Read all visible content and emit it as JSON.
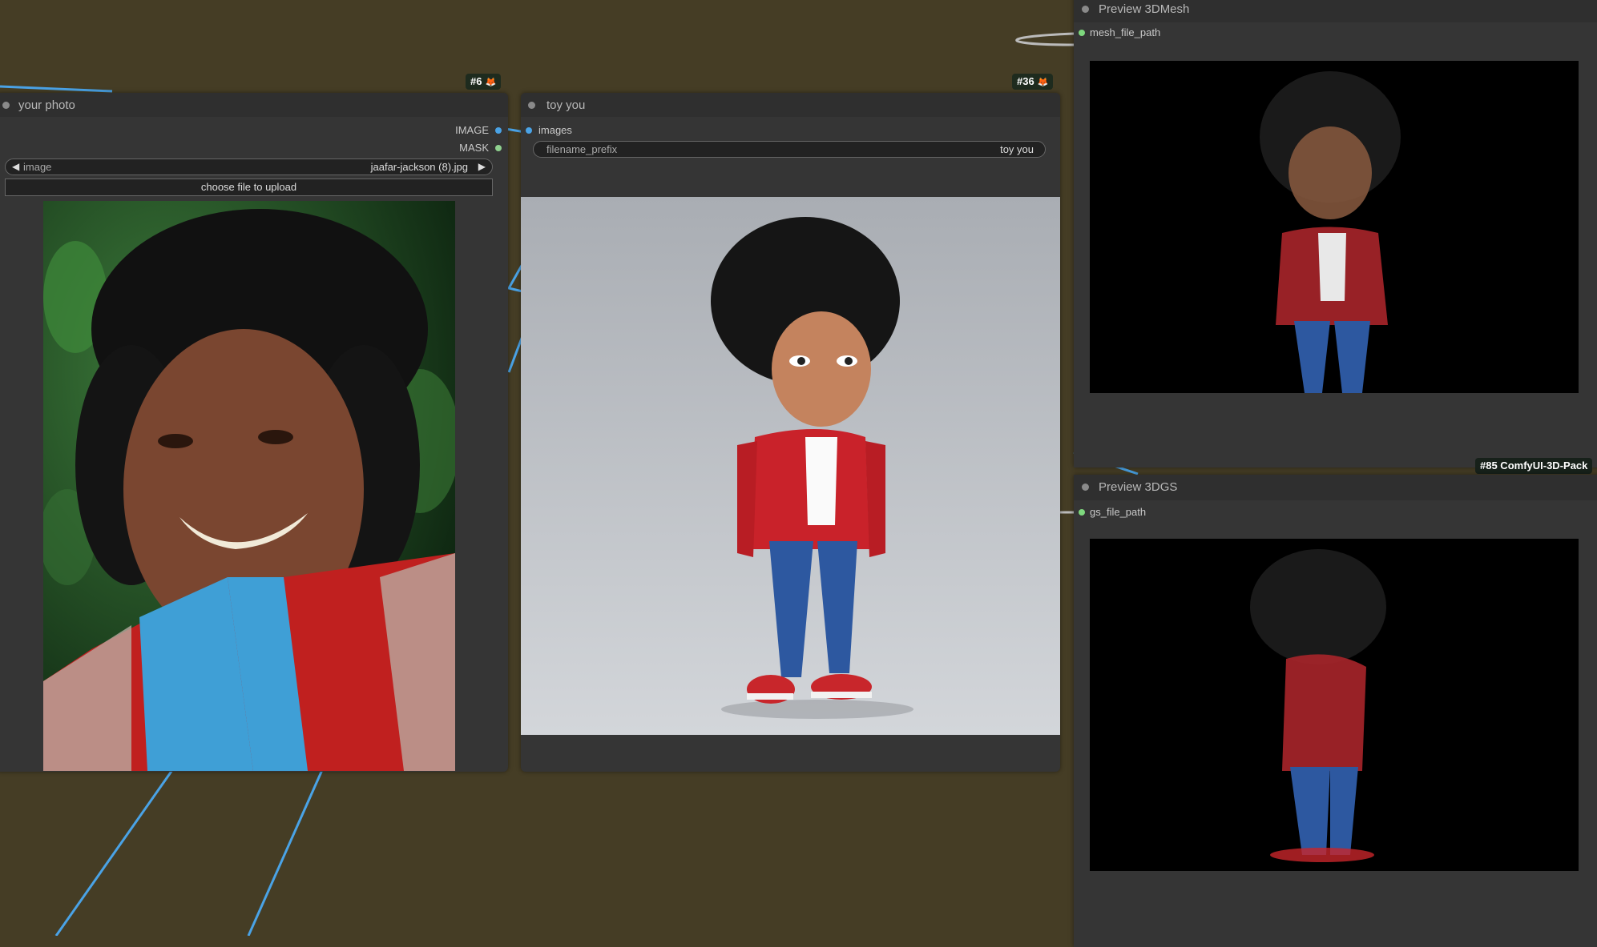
{
  "nodes": {
    "load_image": {
      "title": "your photo",
      "badge_id": "#6",
      "outputs": [
        "IMAGE",
        "MASK"
      ],
      "image_widget": {
        "label": "image",
        "value": "jaafar-jackson (8).jpg"
      },
      "upload_label": "choose file to upload"
    },
    "save_image": {
      "title": "toy you",
      "badge_id": "#36",
      "input": "images",
      "prefix_widget": {
        "label": "filename_prefix",
        "value": "toy you"
      }
    },
    "preview_mesh": {
      "title": "Preview 3DMesh",
      "input": "mesh_file_path"
    },
    "preview_gs": {
      "title": "Preview 3DGS",
      "input": "gs_file_path",
      "badge": "#85 ComfyUI-3D-Pack"
    }
  },
  "colors": {
    "canvas": "#453d25",
    "node_bg": "#353535",
    "link_image": "#4aa3e6",
    "slot_mask": "#8fd18f",
    "slot_string": "#7ed87e"
  }
}
